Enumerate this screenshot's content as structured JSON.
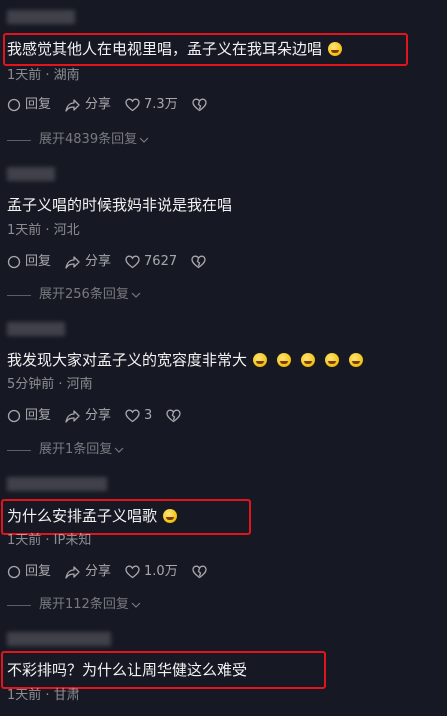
{
  "comments": [
    {
      "text": "我感觉其他人在电视里唱，孟子义在我耳朵边唱",
      "meta": "1天前 · 湖南",
      "reply": "回复",
      "share": "分享",
      "likes": "7.3万",
      "expand": "展开4839条回复"
    },
    {
      "text": "孟子义唱的时候我妈非说是我在唱",
      "meta": "1天前 · 河北",
      "reply": "回复",
      "share": "分享",
      "likes": "7627",
      "expand": "展开256条回复"
    },
    {
      "text": "我发现大家对孟子义的宽容度非常大",
      "meta": "5分钟前 · 河南",
      "reply": "回复",
      "share": "分享",
      "likes": "3",
      "expand": "展开1条回复"
    },
    {
      "text": "为什么安排孟子义唱歌",
      "meta": "1天前 · IP未知",
      "reply": "回复",
      "share": "分享",
      "likes": "1.0万",
      "expand": "展开112条回复"
    },
    {
      "text": "不彩排吗？为什么让周华健这么难受",
      "meta": "1天前 · 甘肃"
    }
  ],
  "icons": {
    "reply": "reply-icon",
    "share": "share-icon",
    "like": "heart-icon",
    "dislike": "broken-heart-icon",
    "expand": "chevron-down-icon",
    "emoji_1": "smiling-emoji-icon",
    "emoji_laugh": "laughing-tears-emoji-icon"
  },
  "colors": {
    "background": "#161823",
    "highlight_box": "#e3141c"
  }
}
